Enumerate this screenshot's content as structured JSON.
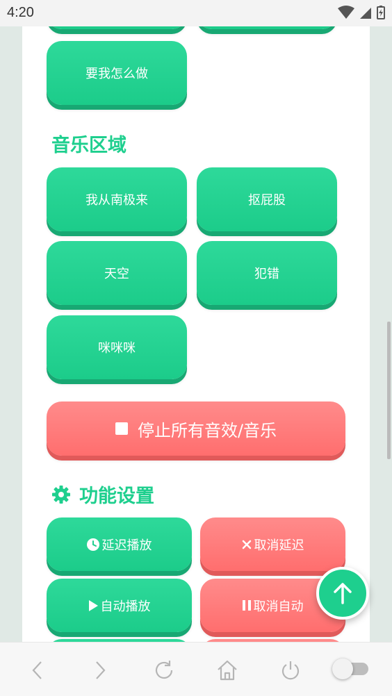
{
  "status_bar": {
    "time": "4:20"
  },
  "buttons": {
    "what_do_i_do": "要我怎么做",
    "from_antarctica": "我从南极来",
    "pick_butt": "抠屁股",
    "sky": "天空",
    "mistake": "犯错",
    "mimimi": "咪咪咪",
    "stop_all": "停止所有音效/音乐",
    "delay_play": "延迟播放",
    "cancel_delay": "取消延迟",
    "auto_play": "自动播放",
    "cancel_auto": "取消自动"
  },
  "sections": {
    "music": "音乐区域",
    "settings": "功能设置"
  },
  "colors": {
    "green": "#1ecf8e",
    "red": "#ff7b7b"
  },
  "icons": {
    "stop": "stop-square-icon",
    "settings": "gear-icon",
    "delay": "clock-icon",
    "cancel": "x-icon",
    "play": "play-icon",
    "pause": "pause-icon",
    "scroll_top": "arrow-up-icon",
    "back": "chevron-left-icon",
    "forward": "chevron-right-icon",
    "reload": "reload-icon",
    "home": "home-icon",
    "power": "power-icon"
  }
}
